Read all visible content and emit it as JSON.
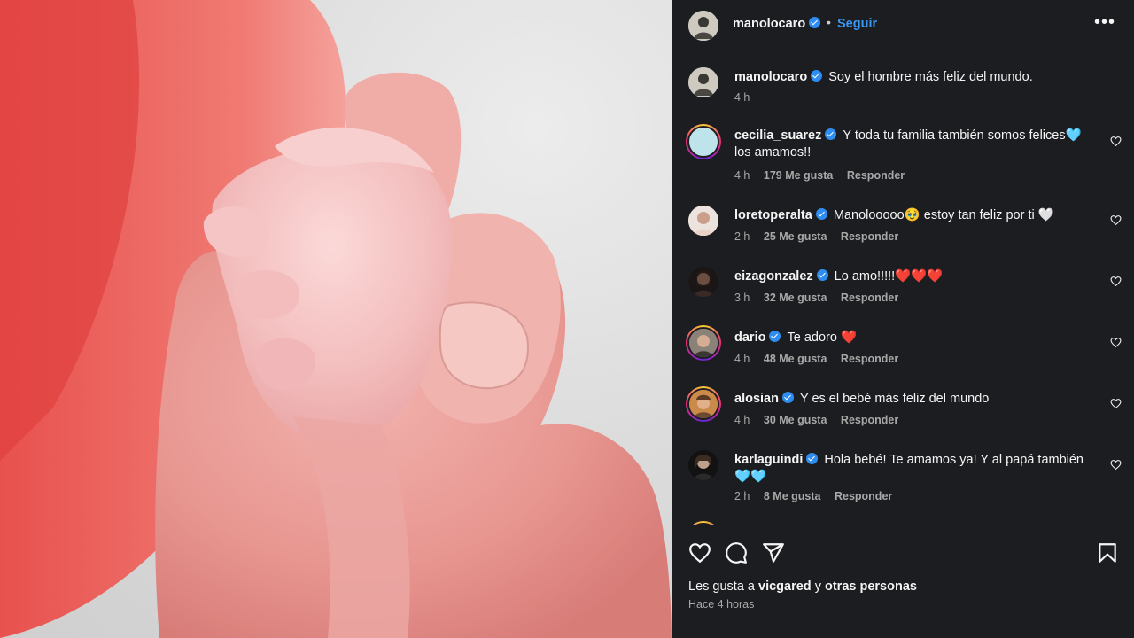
{
  "post": {
    "username": "manolocaro",
    "separator": "•",
    "follow_label": "Seguir",
    "more_label": "•••",
    "caption": "Soy el hombre más feliz del mundo.",
    "caption_time": "4 h"
  },
  "comments": [
    {
      "user": "cecilia_suarez",
      "text": "Y toda tu familia también somos felices🩵 los amamos!!",
      "time": "4 h",
      "likes": "179 Me gusta",
      "reply": "Responder"
    },
    {
      "user": "loretoperalta",
      "text": "Manolooooo🥹 estoy tan feliz por ti 🤍",
      "time": "2 h",
      "likes": "25 Me gusta",
      "reply": "Responder"
    },
    {
      "user": "eizagonzalez",
      "text": "Lo amo!!!!!❤️❤️❤️",
      "time": "3 h",
      "likes": "32 Me gusta",
      "reply": "Responder"
    },
    {
      "user": "dario",
      "text": "Te adoro ❤️",
      "time": "4 h",
      "likes": "48 Me gusta",
      "reply": "Responder"
    },
    {
      "user": "alosian",
      "text": "Y es el bebé más feliz del mundo",
      "time": "4 h",
      "likes": "30 Me gusta",
      "reply": "Responder"
    },
    {
      "user": "karlaguindi",
      "text": "Hola bebé! Te amamos ya! Y al papá también 🩵🩵",
      "time": "2 h",
      "likes": "8 Me gusta",
      "reply": "Responder"
    }
  ],
  "likes_summary": {
    "prefix": "Les gusta a",
    "user": "vicgared",
    "middle": "y",
    "others": "otras personas"
  },
  "post_time": "Hace 4 horas",
  "icons": [
    "verified-badge-icon",
    "heart-icon",
    "comment-icon",
    "share-icon",
    "bookmark-icon",
    "more-options-icon"
  ],
  "colors": {
    "follow": "#3897f0",
    "verified": "#2f8cf0",
    "panel_bg": "#1c1d21",
    "muted": "#a8a8a8"
  }
}
